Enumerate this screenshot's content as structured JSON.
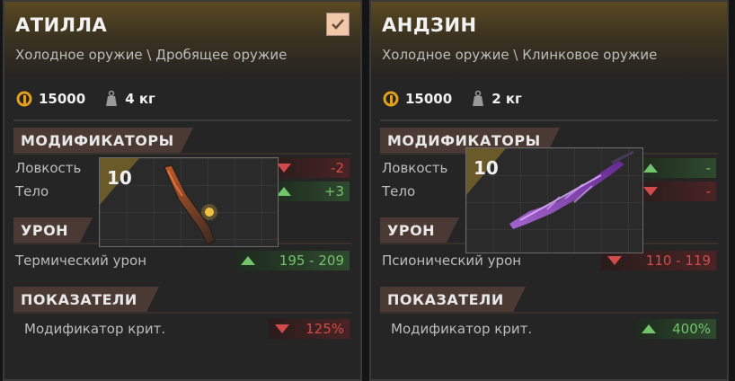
{
  "left": {
    "name": "АТИЛЛА",
    "category": "Холодное оружие \\ Дробящее оружие",
    "price": "15000",
    "weight": "4 кг",
    "checked": true,
    "sections": {
      "mods": "МОДИФИКАТОРЫ",
      "damage": "УРОН",
      "stats": "ПОКАЗАТЕЛИ"
    },
    "mods": [
      {
        "label": "Ловкость",
        "value": "-2",
        "dir": "down"
      },
      {
        "label": "Тело",
        "value": "+3",
        "dir": "up"
      }
    ],
    "damage": {
      "label": "Термический урон",
      "value": "195 - 209",
      "dir": "up"
    },
    "stat": {
      "label": "Модификатор крит.",
      "value": "125%",
      "dir": "down"
    },
    "level": "10"
  },
  "right": {
    "name": "АНДЗИН",
    "category": "Холодное оружие \\ Клинковое оружие",
    "price": "15000",
    "weight": "2 кг",
    "checked": false,
    "sections": {
      "mods": "МОДИФИКАТОРЫ",
      "damage": "УРОН",
      "stats": "ПОКАЗАТЕЛИ"
    },
    "mods": [
      {
        "label": "Ловкость",
        "value": "-",
        "dir": "up"
      },
      {
        "label": "Тело",
        "value": "-",
        "dir": "down"
      }
    ],
    "damage": {
      "label": "Псионический урон",
      "value": "110 - 119",
      "dir": "down"
    },
    "stat": {
      "label": "Модификатор крит.",
      "value": "400%",
      "dir": "up"
    },
    "level": "10"
  },
  "colors": {
    "up": "#72c46a",
    "down": "#d24a4a",
    "accent": "#f2c9a8",
    "section": "#4a3a33"
  },
  "icons": {
    "price": "coin-icon",
    "weight": "weight-icon",
    "check": "checkmark-icon",
    "up": "arrow-up-icon",
    "down": "arrow-down-icon"
  }
}
